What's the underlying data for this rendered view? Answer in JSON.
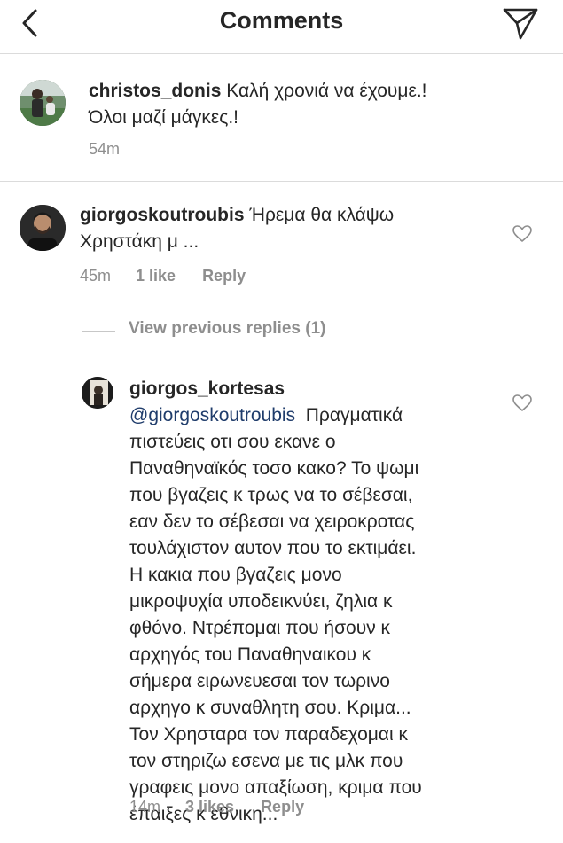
{
  "header": {
    "title": "Comments"
  },
  "caption": {
    "username": "christos_donis",
    "text_line1": "Καλή χρονιά να έχουμε.!",
    "text_line2": "Όλοι μαζί μάγκες.!",
    "time": "54m"
  },
  "comment1": {
    "username": "giorgoskoutroubis",
    "text_line1": "Ήρεμα θα κλάψω",
    "text_line2": "Χρηστάκη μ ...",
    "time": "45m",
    "likes": "1 like",
    "reply": "Reply"
  },
  "view_previous": "View previous replies (1)",
  "reply1": {
    "username": "giorgos_kortesas",
    "mention": "@giorgoskoutroubis",
    "lines": [
      "Πραγματικά",
      "πιστεύεις οτι σου εκανε ο",
      "Παναθηναϊκός τοσο κακο? Το ψωμι",
      "που βγαζεις κ τρως να το σέβεσαι,",
      "εαν δεν το σέβεσαι να χειροκροτας",
      "τουλάχιστον αυτον που το  εκτιμάει.",
      "Η κακια που βγαζεις μονο",
      "μικροψυχία υποδεικνύει, ζηλια κ",
      "φθόνο. Ντρέπομαι που ήσουν κ",
      "αρχηγός του Παναθηναικου κ",
      "σήμερα ειρωνευεσαι τον τωρινο",
      "αρχηγο κ συναθλητη σου. Κριμα...",
      "Τον Χρησταρα τον παραδεχομαι κ",
      "τον στηριζω εσενα με τις μλκ που",
      "γραφεις μονο απαξίωση, κριμα που",
      "έπαιξες κ εθνικη..."
    ],
    "time": "14m",
    "likes": "3 likes",
    "reply": "Reply"
  },
  "icons": {
    "back": "chevron-left-icon",
    "send": "paper-plane-icon",
    "like": "heart-outline-icon"
  },
  "colors": {
    "text": "#262626",
    "meta": "#8e8e8e",
    "mention": "#1f3c6b",
    "divider": "#dbdbdb"
  }
}
